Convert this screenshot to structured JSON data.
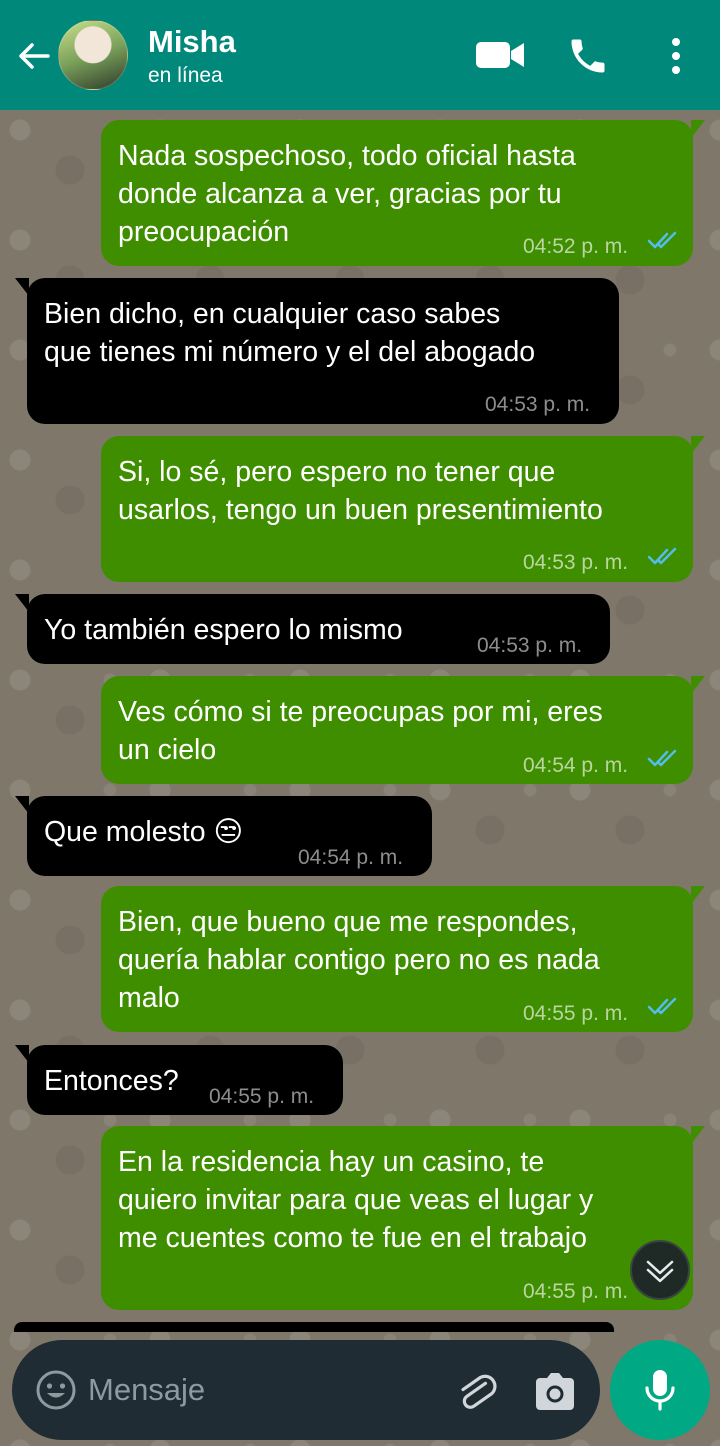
{
  "header": {
    "contact_name": "Misha",
    "status": "en línea",
    "color": "#00897b"
  },
  "messages": [
    {
      "dir": "out",
      "lines": [
        "Nada sospechoso, todo oficial hasta",
        "donde alcanza a ver, gracias por tu",
        "preocupación"
      ],
      "time": "04:52 p. m.",
      "read": true
    },
    {
      "dir": "in",
      "lines": [
        "Bien dicho, en cualquier caso sabes",
        "que tienes mi número y el del abogado"
      ],
      "time": "04:53 p. m."
    },
    {
      "dir": "out",
      "lines": [
        "Si, lo sé, pero espero no tener que",
        "usarlos, tengo un buen presentimiento"
      ],
      "time": "04:53 p. m.",
      "read": true
    },
    {
      "dir": "in",
      "lines": [
        "Yo también espero lo mismo"
      ],
      "time": "04:53 p. m."
    },
    {
      "dir": "out",
      "lines": [
        "Ves cómo si te preocupas por mi, eres",
        "un cielo"
      ],
      "time": "04:54 p. m.",
      "read": true
    },
    {
      "dir": "in",
      "lines": [
        "Que molesto 😒"
      ],
      "time": "04:54 p. m."
    },
    {
      "dir": "out",
      "lines": [
        "Bien, que bueno que me respondes,",
        "quería hablar contigo pero no es nada",
        "malo"
      ],
      "time": "04:55 p. m.",
      "read": true
    },
    {
      "dir": "in",
      "lines": [
        "Entonces?"
      ],
      "time": "04:55 p. m."
    },
    {
      "dir": "out",
      "lines": [
        "En la residencia hay un casino, te",
        "quiero invitar para que veas el lugar y",
        "me cuentes como te fue en el trabajo"
      ],
      "time": "04:55 p. m.",
      "read": true
    }
  ],
  "input": {
    "placeholder": "Mensaje",
    "value": ""
  },
  "icons": {
    "back": "arrow-left-icon",
    "video": "video-camera-icon",
    "call": "phone-icon",
    "menu": "more-vert-icon",
    "emoji": "emoji-icon",
    "attach": "paperclip-icon",
    "camera": "camera-icon",
    "mic": "microphone-icon",
    "scroll": "double-chevron-down-icon"
  },
  "colors": {
    "outgoing_bubble": "#3f8e00",
    "incoming_bubble": "#000000",
    "read_ticks": "#53bdeb",
    "mic_button": "#00a884"
  }
}
